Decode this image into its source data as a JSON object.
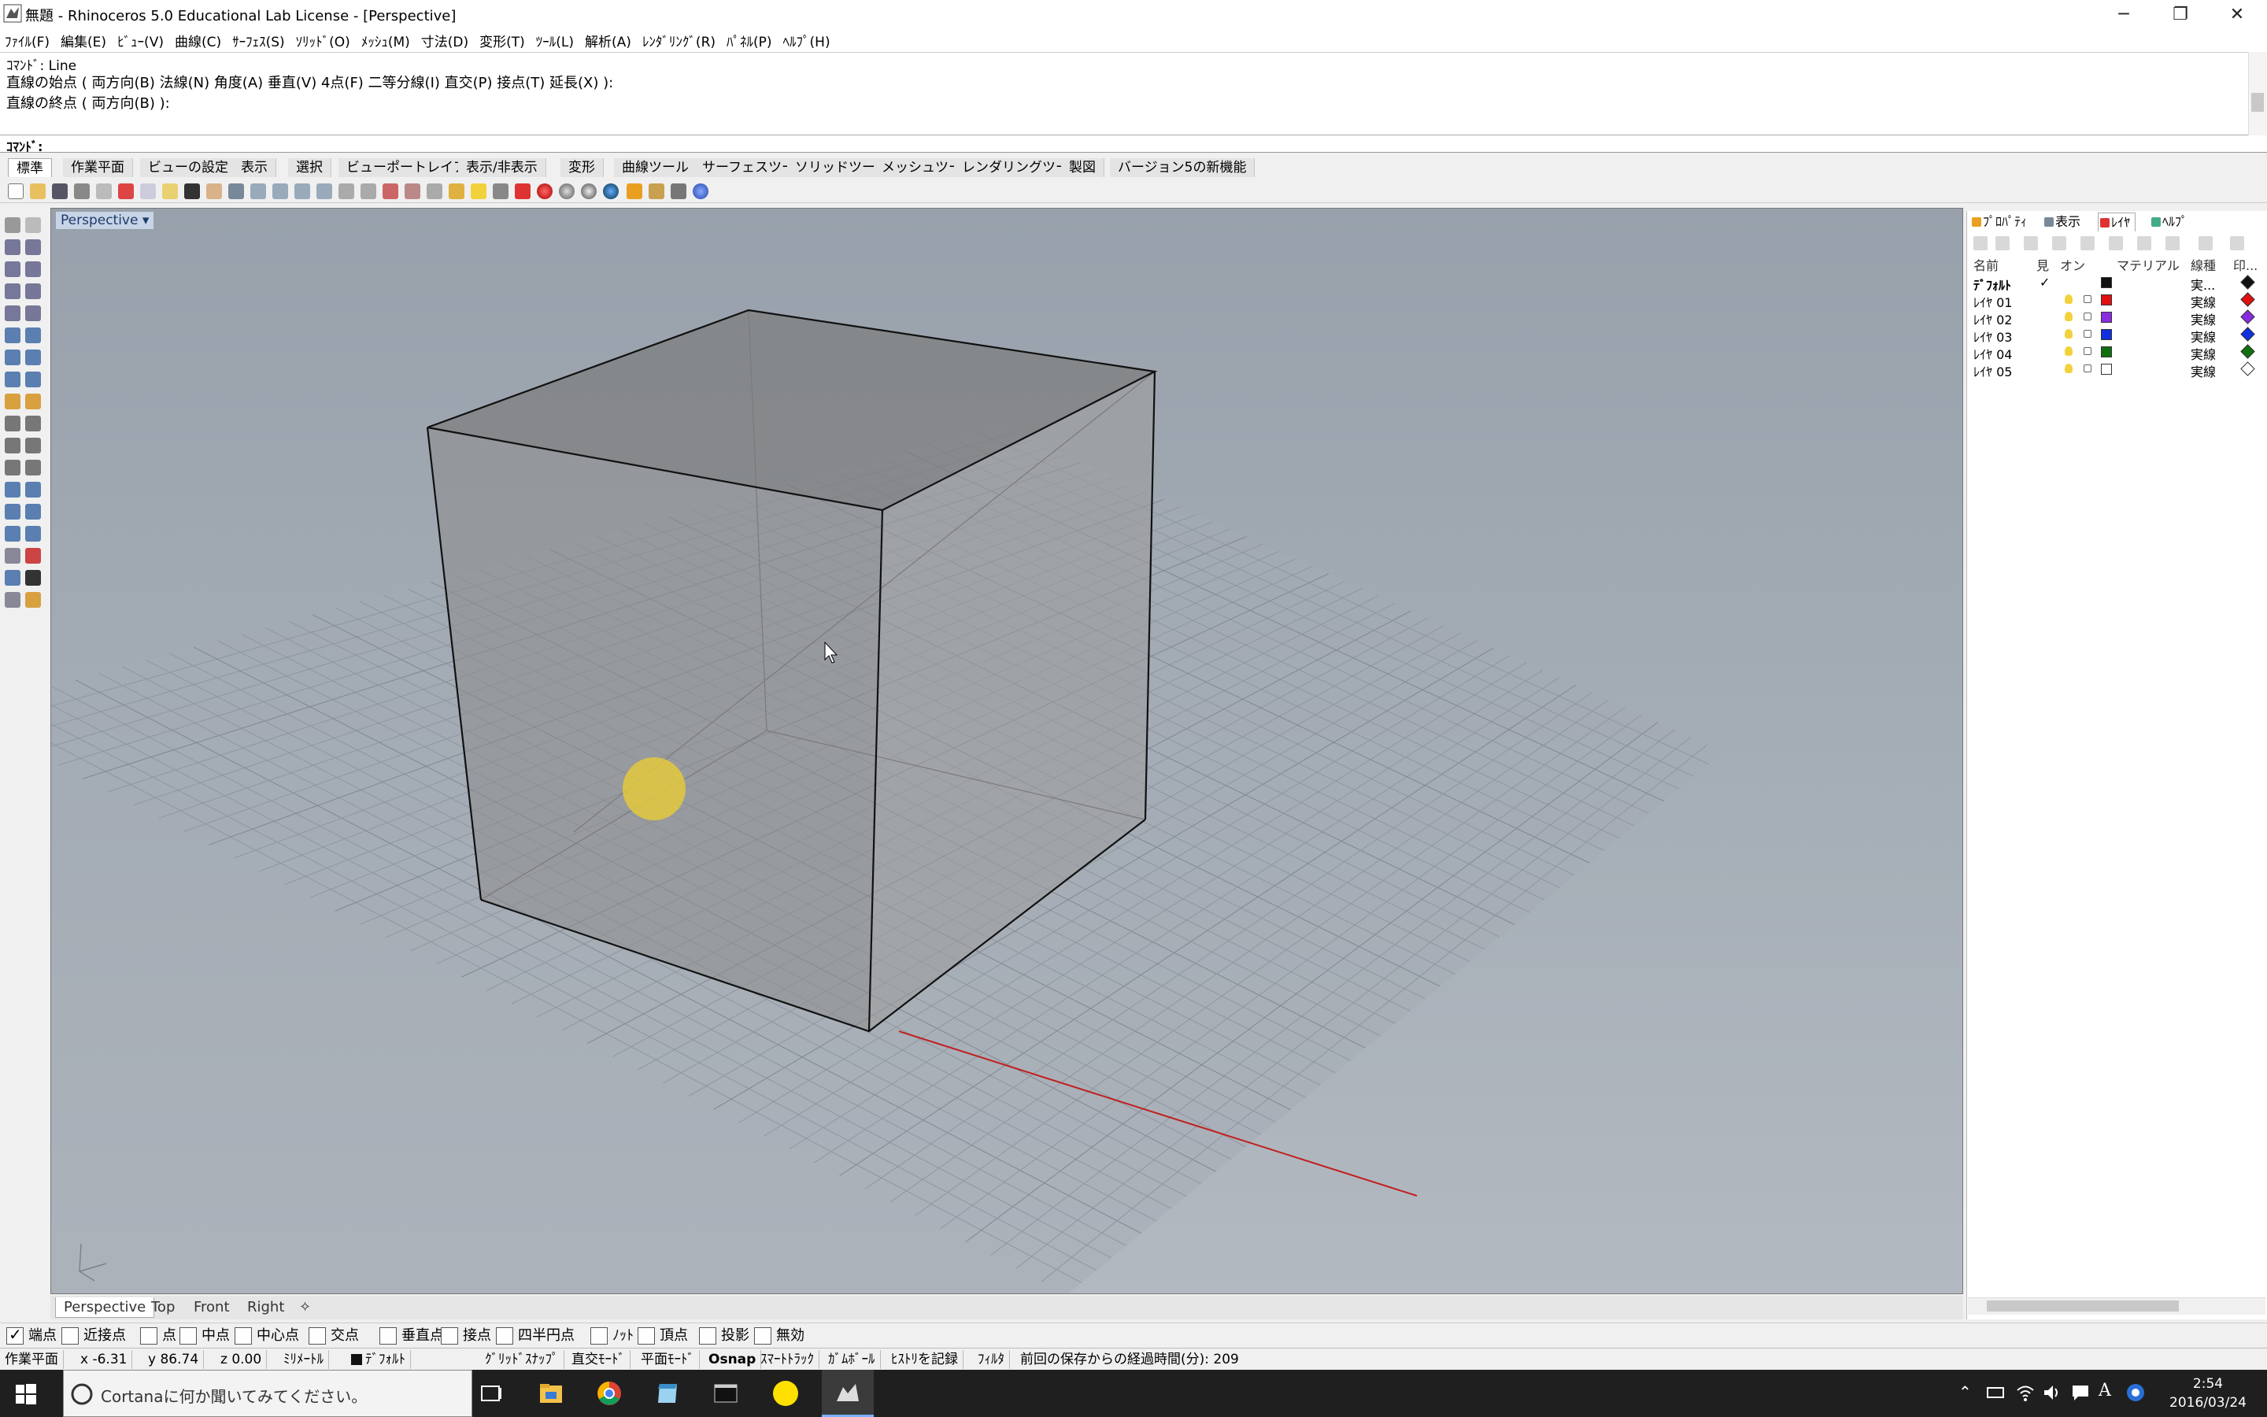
{
  "titlebar": {
    "title": "無題 - Rhinoceros 5.0 Educational Lab License - [Perspective]",
    "minimize": "─",
    "restore": "❐",
    "close": "✕"
  },
  "menu": [
    "ﾌｧｲﾙ(F)",
    "編集(E)",
    "ﾋﾞｭｰ(V)",
    "曲線(C)",
    "ｻｰﾌｪｽ(S)",
    "ｿﾘｯﾄﾞ(O)",
    "ﾒｯｼｭ(M)",
    "寸法(D)",
    "変形(T)",
    "ﾂｰﾙ(L)",
    "解析(A)",
    "ﾚﾝﾀﾞﾘﾝｸﾞ(R)",
    "ﾊﾟﾈﾙ(P)",
    "ﾍﾙﾌﾟ(H)"
  ],
  "command": {
    "history": [
      "ｺﾏﾝﾄﾞ: Line",
      "直線の始点 ( 両方向(B) 法線(N) 角度(A) 垂直(V) 4点(F) 二等分線(I) 直交(P) 接点(T) 延長(X) ):",
      "直線の終点 ( 両方向(B) ):"
    ],
    "prompt": "ｺﾏﾝﾄﾞ:"
  },
  "tabs": [
    "標準",
    "作業平面",
    "ビューの設定",
    "表示",
    "選択",
    "ビューポートレイアウト",
    "表示/非表示",
    "変形",
    "曲線ツール",
    "サーフェスツール",
    "ソリッドツール",
    "メッシュツール",
    "レンダリングツール",
    "製図",
    "バージョン5の新機能"
  ],
  "viewport": {
    "label": "Perspective",
    "menu_arrow": "▾"
  },
  "view_tabs": [
    "Perspective",
    "Top",
    "Front",
    "Right",
    "✧"
  ],
  "panel": {
    "tabs": [
      "ﾌﾟﾛﾊﾟﾃｨ",
      "表示",
      "ﾚｲﾔ",
      "ﾍﾙﾌﾟ"
    ],
    "columns": [
      "名前",
      "見",
      "オン",
      "マテリアル",
      "線種",
      "印..."
    ],
    "layers": [
      {
        "name": "ﾃﾞﾌｫﾙﾄ",
        "current": "✓",
        "linetype": "実...",
        "color": "#111111"
      },
      {
        "name": "ﾚｲﾔ 01",
        "current": "",
        "linetype": "実線",
        "color": "#e01010"
      },
      {
        "name": "ﾚｲﾔ 02",
        "current": "",
        "linetype": "実線",
        "color": "#8a2be2"
      },
      {
        "name": "ﾚｲﾔ 03",
        "current": "",
        "linetype": "実線",
        "color": "#1030e0"
      },
      {
        "name": "ﾚｲﾔ 04",
        "current": "",
        "linetype": "実線",
        "color": "#107010"
      },
      {
        "name": "ﾚｲﾔ 05",
        "current": "",
        "linetype": "実線",
        "color": "#ffffff"
      }
    ]
  },
  "osnaps": [
    {
      "label": "端点",
      "on": true
    },
    {
      "label": "近接点",
      "on": false
    },
    {
      "label": "点",
      "on": false
    },
    {
      "label": "中点",
      "on": false
    },
    {
      "label": "中心点",
      "on": false
    },
    {
      "label": "交点",
      "on": false
    },
    {
      "label": "垂直点",
      "on": false
    },
    {
      "label": "接点",
      "on": false
    },
    {
      "label": "四半円点",
      "on": false
    },
    {
      "label": "ﾉｯﾄ",
      "on": false
    },
    {
      "label": "頂点",
      "on": false
    },
    {
      "label": "投影",
      "on": false
    },
    {
      "label": "無効",
      "on": false
    }
  ],
  "status": {
    "cplane": "作業平面",
    "x": "x -6.31",
    "y": "y 86.74",
    "z": "z 0.00",
    "units": "ﾐﾘﾒｰﾄﾙ",
    "layer": "ﾃﾞﾌｫﾙﾄ",
    "grid_snap": "ｸﾞﾘｯﾄﾞｽﾅｯﾌﾟ",
    "ortho": "直交ﾓｰﾄﾞ",
    "planar": "平面ﾓｰﾄﾞ",
    "osnap": "Osnap",
    "smarttrack": "ｽﾏｰﾄﾄﾗｯｸ",
    "gumball": "ｶﾞﾑﾎﾞｰﾙ",
    "history": "ﾋｽﾄﾘを記録",
    "filter": "ﾌｨﾙﾀ",
    "autosave": "前回の保存からの経過時間(分): 209"
  },
  "taskbar": {
    "search_placeholder": "Cortanaに何か聞いてみてください。",
    "time": "2:54",
    "date": "2016/03/24"
  }
}
